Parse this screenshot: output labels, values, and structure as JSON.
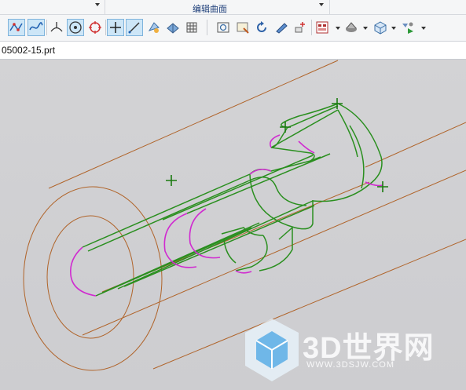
{
  "ribbon": {
    "group_label": "编辑曲面"
  },
  "toolbar": {
    "icons": [
      "curve-icon",
      "spline-icon",
      "normal-icon",
      "point-on-face-icon",
      "circle-snap-icon",
      "intersection-icon",
      "line-icon",
      "view-orient-icon",
      "shaded-icon",
      "pattern-icon",
      "fit-view-icon",
      "zoom-window-icon",
      "rotate-icon",
      "section-icon",
      "layer-icon",
      "render-style-icon",
      "display-icon",
      "box-view-icon",
      "filter-icon"
    ]
  },
  "tabs": {
    "file_name": "05002-15.prt"
  },
  "watermark": {
    "brand": "3D世界网",
    "url": "WWW.3DSJW.COM"
  },
  "colors": {
    "cylinder_edges": "#b0642a",
    "path_green": "#2a8f1f",
    "profile_magenta": "#d02ad0",
    "point_marker": "#1a7a10",
    "background": "#d0d0d3"
  }
}
